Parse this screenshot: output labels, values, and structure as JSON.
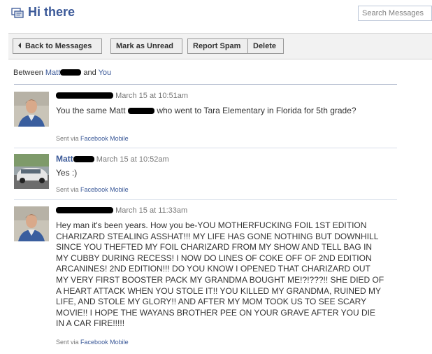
{
  "header": {
    "title": "Hi there",
    "title_icon": "messages-icon",
    "search_placeholder": "Search Messages"
  },
  "toolbar": {
    "back_label": "Back to Messages",
    "mark_unread_label": "Mark as Unread",
    "report_spam_label": "Report Spam",
    "delete_label": "Delete"
  },
  "thread": {
    "between_prefix": "Between",
    "participant_first": "Matt",
    "and_label": "and",
    "you_label": "You"
  },
  "messages": [
    {
      "sender": "",
      "sender_redacted": true,
      "timestamp": "March 15 at 10:51am",
      "body_before": "You the same Matt",
      "body_redacted": true,
      "body_after": "who went to Tara Elementary in Florida for 5th grade?",
      "sent_via_prefix": "Sent via",
      "sent_via_link": "Facebook Mobile"
    },
    {
      "sender": "Matt",
      "sender_redacted": true,
      "timestamp": "March 15 at 10:52am",
      "body": "Yes :)",
      "sent_via_prefix": "Sent via",
      "sent_via_link": "Facebook Mobile"
    },
    {
      "sender": "",
      "sender_redacted": true,
      "timestamp": "March 15 at 11:33am",
      "body": "Hey man it's been years. How you be-YOU MOTHERFUCKING FOIL 1ST EDITION CHARIZARD STEALING ASSHAT!!! MY LIFE HAS GONE NOTHING BUT DOWNHILL SINCE YOU THEFTED MY FOIL CHARIZARD FROM MY SHOW AND TELL BAG IN MY CUBBY DURING RECESS! I NOW DO LINES OF COKE OFF OF 2ND EDITION ARCANINES! 2ND EDITION!!! DO YOU KNOW I OPENED THAT CHARIZARD OUT MY VERY FIRST BOOSTER PACK MY GRANDMA BOUGHT ME!?!???!! SHE DIED OF A HEART ATTACK WHEN YOU STOLE IT!! YOU KILLED MY GRANDMA, RUINED MY LIFE, AND STOLE MY GLORY!! AND AFTER MY MOM TOOK US TO SEE SCARY MOVIE!! I HOPE THE WAYANS BROTHER PEE ON YOUR GRAVE AFTER YOU DIE IN A CAR FIRE!!!!!",
      "sent_via_prefix": "Sent via",
      "sent_via_link": "Facebook Mobile"
    }
  ],
  "colors": {
    "link": "#3b5998",
    "toolbar_bg": "#f2f2f2",
    "divider": "#d8dfea"
  }
}
